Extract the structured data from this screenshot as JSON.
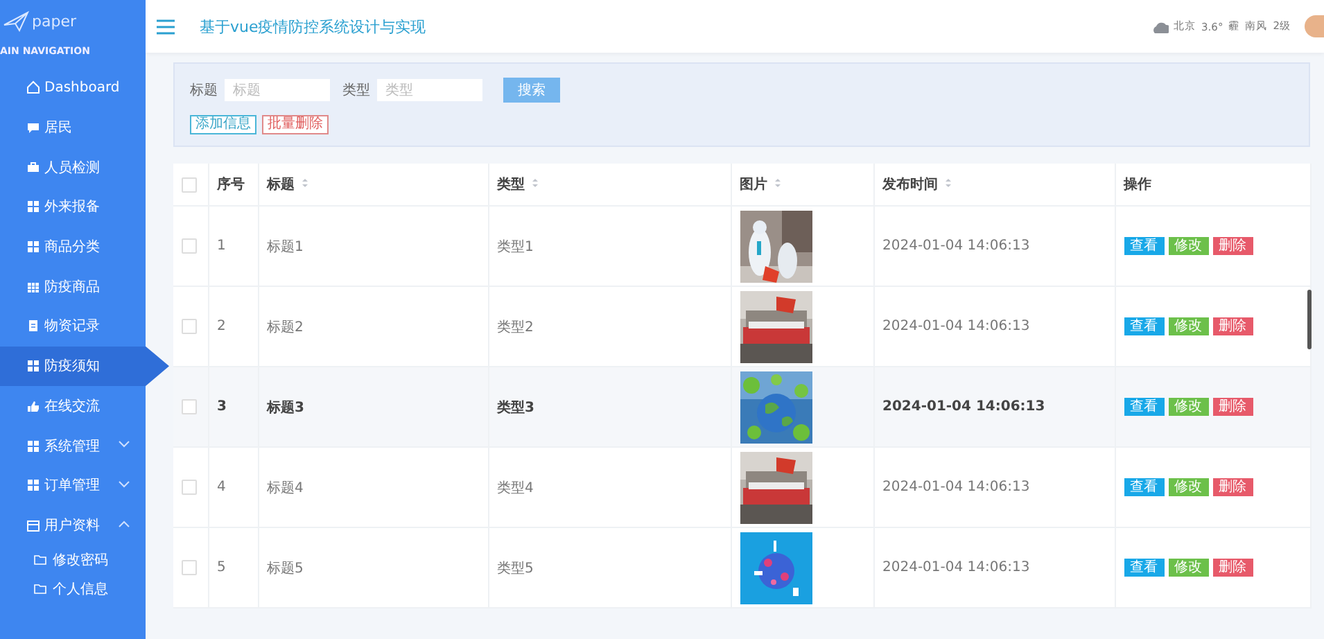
{
  "sidebar": {
    "logo": "paper",
    "section": "AIN NAVIGATION",
    "items": [
      {
        "label": "Dashboard",
        "selected": false
      },
      {
        "label": "居民",
        "selected": false
      },
      {
        "label": "人员检测",
        "selected": false
      },
      {
        "label": "外来报备",
        "selected": false
      },
      {
        "label": "商品分类",
        "selected": false
      },
      {
        "label": "防疫商品",
        "selected": false
      },
      {
        "label": "物资记录",
        "selected": false
      },
      {
        "label": "防疫须知",
        "selected": true
      },
      {
        "label": "在线交流",
        "selected": false
      },
      {
        "label": "系统管理",
        "selected": false,
        "expanded": false
      },
      {
        "label": "订单管理",
        "selected": false,
        "expanded": false
      },
      {
        "label": "用户资料",
        "selected": false,
        "expanded": true,
        "children": [
          {
            "label": "修改密码",
            "selected": false
          },
          {
            "label": "个人信息",
            "selected": false
          }
        ]
      }
    ]
  },
  "header": {
    "title": "基于vue疫情防控系统设计与实现",
    "weather": {
      "city": "北京",
      "temperature": "3.6°",
      "condition": "霾",
      "wind": "南风",
      "level": "2级"
    }
  },
  "search": {
    "fields": [
      {
        "label": "标题",
        "placeholder": "标题"
      },
      {
        "label": "类型",
        "placeholder": "类型"
      }
    ],
    "search_button": "搜索",
    "add_button": "添加信息",
    "delete_button": "批量删除"
  },
  "table": {
    "all_checked": false,
    "columns": [
      {
        "label": "序号",
        "sortable": false
      },
      {
        "label": "标题",
        "sortable": true
      },
      {
        "label": "类型",
        "sortable": true
      },
      {
        "label": "图片",
        "sortable": true
      },
      {
        "label": "发布时间",
        "sortable": true
      },
      {
        "label": "操作",
        "sortable": false
      }
    ],
    "rows": [
      {
        "index": "1",
        "title": "标题1",
        "type": "类型1",
        "time": "2024-01-04 14:06:13",
        "checked": false,
        "hovered": false,
        "actions": [
          "查看",
          "修改",
          "删除"
        ]
      },
      {
        "index": "2",
        "title": "标题2",
        "type": "类型2",
        "time": "2024-01-04 14:06:13",
        "checked": false,
        "hovered": false,
        "actions": [
          "查看",
          "修改",
          "删除"
        ]
      },
      {
        "index": "3",
        "title": "标题3",
        "type": "类型3",
        "time": "2024-01-04 14:06:13",
        "checked": false,
        "hovered": true,
        "actions": [
          "查看",
          "修改",
          "删除"
        ]
      },
      {
        "index": "4",
        "title": "标题4",
        "type": "类型4",
        "time": "2024-01-04 14:06:13",
        "checked": false,
        "hovered": false,
        "actions": [
          "查看",
          "修改",
          "删除"
        ]
      },
      {
        "index": "5",
        "title": "标题5",
        "type": "类型5",
        "time": "2024-01-04 14:06:13",
        "checked": false,
        "hovered": false,
        "actions": [
          "查看",
          "修改",
          "删除"
        ]
      }
    ]
  }
}
